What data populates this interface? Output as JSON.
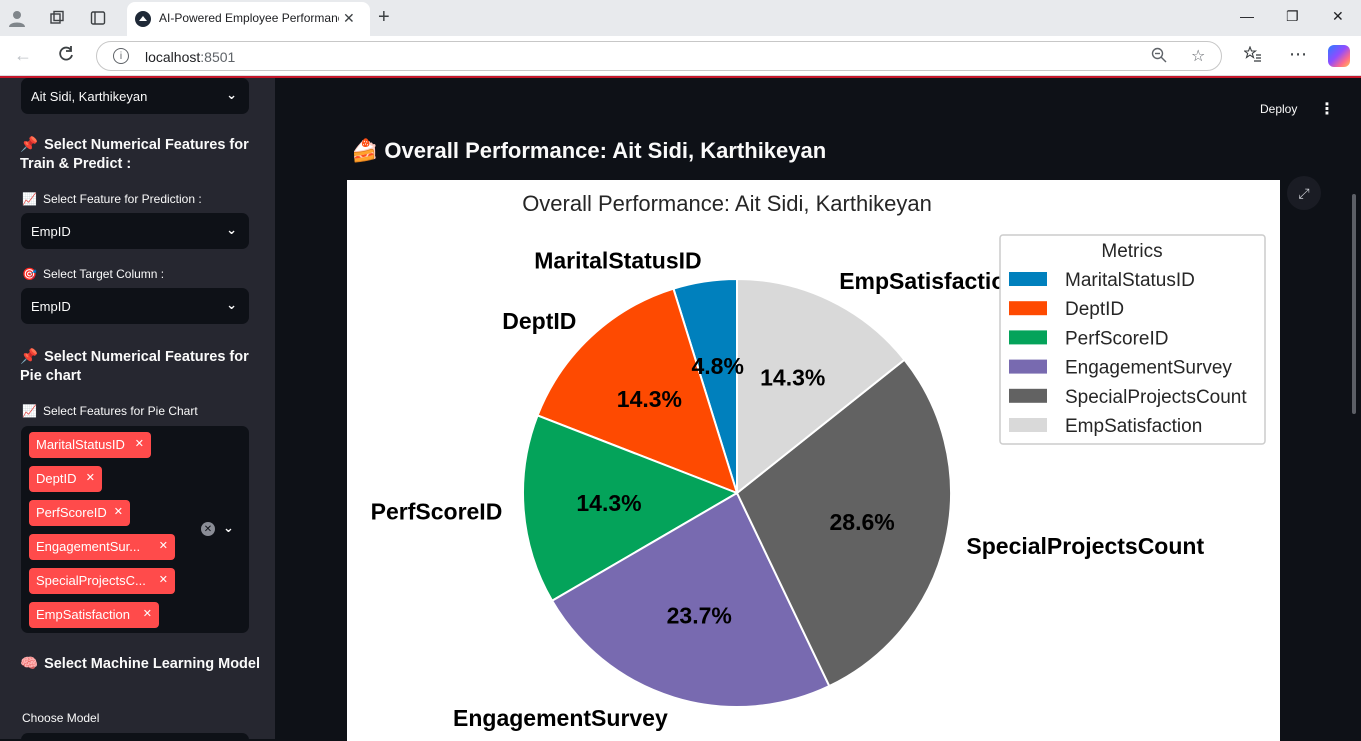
{
  "browser": {
    "tab_title": "AI-Powered Employee Performance",
    "tab_close": "✕",
    "new_tab": "+",
    "url_host": "localhost",
    "url_port": ":8501",
    "window_controls": [
      "—",
      "❐",
      "✕"
    ]
  },
  "header": {
    "deploy_label": "Deploy",
    "menu_icon": "⋮"
  },
  "sidebar": {
    "employee_select": {
      "value": "Ait Sidi, Karthikeyan"
    },
    "section_train": {
      "emoji": "📌",
      "title": "Select Numerical Features for Train & Predict :"
    },
    "feature_label": {
      "emoji": "📈",
      "text": "Select Feature for Prediction :"
    },
    "feature_select": {
      "value": "EmpID"
    },
    "target_label": {
      "emoji": "🎯",
      "text": "Select Target Column :"
    },
    "target_select": {
      "value": "EmpID"
    },
    "section_pie": {
      "emoji": "📌",
      "title": "Select Numerical Features for Pie chart"
    },
    "pie_features_label": {
      "emoji": "📈",
      "text": "Select Features for Pie Chart"
    },
    "pie_features": [
      "MaritalStatusID",
      "DeptID",
      "PerfScoreID",
      "EngagementSur...",
      "SpecialProjectsC...",
      "EmpSatisfaction"
    ],
    "section_ml": {
      "emoji": "🧠",
      "title": "Select Machine Learning Model"
    },
    "model_label": {
      "text": "Choose Model"
    }
  },
  "main": {
    "title_emoji": "🍰",
    "title": "Overall Performance: Ait Sidi, Karthikeyan"
  },
  "chart_data": {
    "type": "pie",
    "title": "Overall Performance: Ait Sidi, Karthikeyan",
    "legend_title": "Metrics",
    "legend_position": "top-right",
    "categories": [
      "MaritalStatusID",
      "DeptID",
      "PerfScoreID",
      "EngagementSurvey",
      "SpecialProjectsCount",
      "EmpSatisfaction"
    ],
    "values": [
      4.8,
      14.3,
      14.3,
      23.7,
      28.6,
      14.3
    ],
    "value_labels": [
      "4.8%",
      "14.3%",
      "14.3%",
      "23.7%",
      "28.6%",
      "14.3%"
    ],
    "colors": [
      "#0080bd",
      "#fe4a01",
      "#04a35a",
      "#786ab0",
      "#626262",
      "#d9d9d9"
    ]
  }
}
